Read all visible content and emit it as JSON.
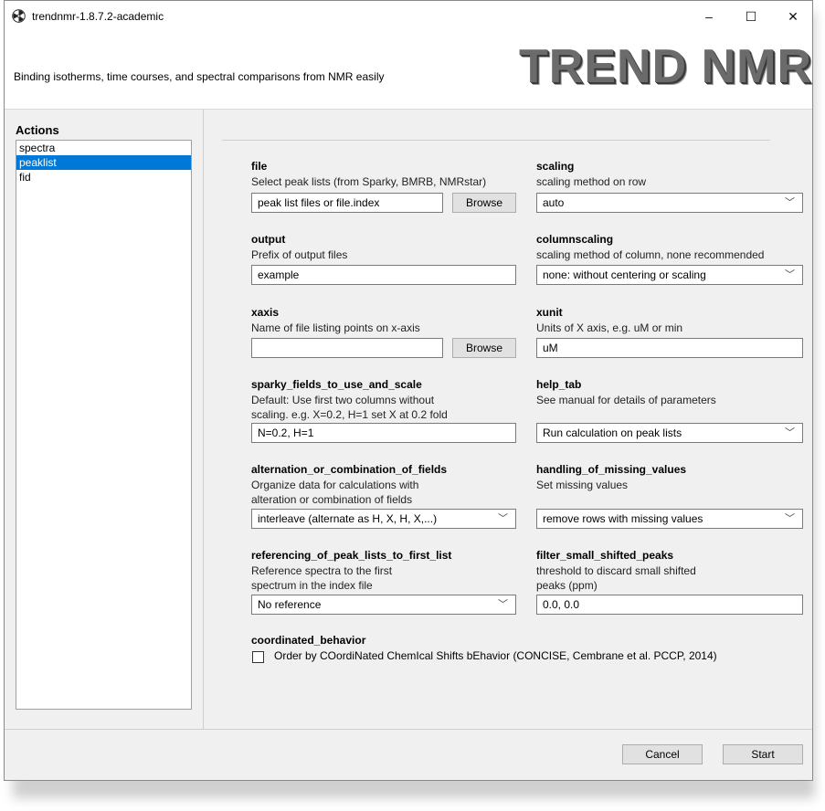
{
  "window": {
    "title": "trendnmr-1.8.7.2-academic",
    "minimize": "–",
    "maximize": "☐",
    "close": "✕"
  },
  "header": {
    "subtitle": "Binding isotherms, time courses, and spectral comparisons from NMR easily",
    "logo_text": "TREND NMR"
  },
  "sidebar": {
    "title": "Actions",
    "items": [
      {
        "label": "spectra"
      },
      {
        "label": "peaklist"
      },
      {
        "label": "fid"
      }
    ],
    "selected": "peaklist"
  },
  "fields": {
    "file": {
      "name": "file",
      "desc": "Select peak lists (from Sparky, BMRB, NMRstar)",
      "value": "peak list files or file.index",
      "button": "Browse"
    },
    "scaling": {
      "name": "scaling",
      "desc": "scaling method on row",
      "value": "auto"
    },
    "output": {
      "name": "output",
      "desc": "Prefix of output files",
      "value": "example"
    },
    "columnscaling": {
      "name": "columnscaling",
      "desc": "scaling method of column, none recommended",
      "value": "none: without centering or scaling"
    },
    "xaxis": {
      "name": "xaxis",
      "desc": "Name of file listing points on x-axis",
      "value": "",
      "button": "Browse"
    },
    "xunit": {
      "name": "xunit",
      "desc": "Units of X axis, e.g. uM or min",
      "value": "uM"
    },
    "sparky": {
      "name": "sparky_fields_to_use_and_scale",
      "desc1": "Default: Use first two columns without",
      "desc2": "scaling. e.g. X=0.2, H=1 set X at 0.2 fold",
      "value": "N=0.2, H=1"
    },
    "help_tab": {
      "name": "help_tab",
      "desc": "See manual for details of parameters",
      "value": "Run calculation on peak lists"
    },
    "alternation": {
      "name": "alternation_or_combination_of_fields",
      "desc1": "Organize data for calculations with",
      "desc2": "alteration or combination of fields",
      "value": "interleave (alternate as H, X, H, X,...)"
    },
    "missing": {
      "name": "handling_of_missing_values",
      "desc": "Set missing values",
      "value": "remove rows with missing values"
    },
    "referencing": {
      "name": "referencing_of_peak_lists_to_first_list",
      "desc1": "Reference spectra to the first",
      "desc2": "spectrum in the index file",
      "value": "No reference"
    },
    "filter": {
      "name": "filter_small_shifted_peaks",
      "desc1": "threshold to discard small shifted",
      "desc2": "peaks (ppm)",
      "value": "0.0, 0.0"
    },
    "coordinated": {
      "name": "coordinated_behavior",
      "checkbox_label": "Order by COordiNated ChemIcal Shifts bEhavior (CONCISE, Cembrane et al. PCCP, 2014)",
      "checked": false
    }
  },
  "footer": {
    "cancel": "Cancel",
    "start": "Start"
  },
  "colors": {
    "selection": "#0078d7",
    "logo": "#6b6b6b"
  }
}
